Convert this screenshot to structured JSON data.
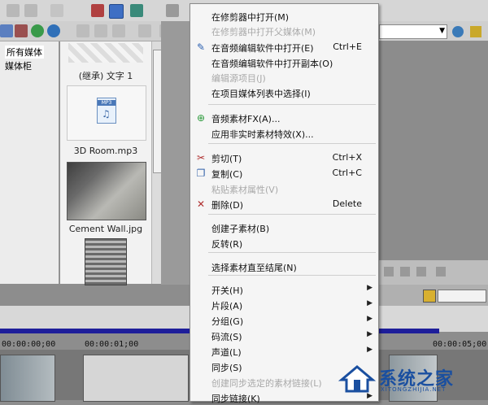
{
  "left_panel": {
    "tree": [
      "所有媒体",
      "媒体柜"
    ],
    "media_items": [
      {
        "label": "(继承) 文字 1"
      },
      {
        "label": "3D Room.mp3",
        "badge": "MP3"
      },
      {
        "label": "Cement Wall.jpg"
      }
    ]
  },
  "timeline": {
    "timecodes": [
      "00:00:00;00",
      "00:00:01;00",
      "00:00:05;00"
    ]
  },
  "context_menu": {
    "items": [
      {
        "label": "在修剪器中打开(M)",
        "disabled": false
      },
      {
        "label": "在修剪器中打开父媒体(M)",
        "disabled": true
      },
      {
        "label": "在音频编辑软件中打开(E)",
        "shortcut": "Ctrl+E",
        "disabled": false,
        "icon": "audio-edit-icon"
      },
      {
        "label": "在音频编辑软件中打开副本(O)",
        "disabled": false
      },
      {
        "label": "编辑源项目(J)",
        "disabled": true
      },
      {
        "label": "在项目媒体列表中选择(I)",
        "disabled": false
      },
      {
        "label": "音频素材FX(A)...",
        "disabled": false,
        "icon": "fx-icon"
      },
      {
        "label": "应用非实时素材特效(X)...",
        "disabled": false
      },
      {
        "label": "剪切(T)",
        "shortcut": "Ctrl+X",
        "disabled": false,
        "icon": "scissors-icon"
      },
      {
        "label": "复制(C)",
        "shortcut": "Ctrl+C",
        "disabled": false,
        "icon": "copy-icon"
      },
      {
        "label": "粘贴素材属性(V)",
        "disabled": true
      },
      {
        "label": "删除(D)",
        "shortcut": "Delete",
        "disabled": false,
        "icon": "delete-icon"
      },
      {
        "label": "创建子素材(B)",
        "disabled": false
      },
      {
        "label": "反转(R)",
        "disabled": false
      },
      {
        "label": "选择素材直至结尾(N)",
        "disabled": false
      },
      {
        "label": "开关(H)",
        "submenu": true,
        "disabled": false
      },
      {
        "label": "片段(A)",
        "submenu": true,
        "disabled": false
      },
      {
        "label": "分组(G)",
        "submenu": true,
        "disabled": false
      },
      {
        "label": "码流(S)",
        "submenu": true,
        "disabled": false
      },
      {
        "label": "声道(L)",
        "submenu": true,
        "disabled": false
      },
      {
        "label": "同步(S)",
        "disabled": false
      },
      {
        "label": "创建同步选定的素材链接(L)",
        "disabled": true
      },
      {
        "label": "同步链接(K)",
        "submenu": true,
        "disabled": false
      }
    ]
  },
  "watermark": {
    "text": "系统之家",
    "sub": "XITONGZHIJIA.NET"
  },
  "colors": {
    "accent_blue": "#1e1e9a",
    "menu_bg": "#f5f5f5",
    "disabled": "#a9a9a9",
    "watermark": "#1a4fa0"
  }
}
